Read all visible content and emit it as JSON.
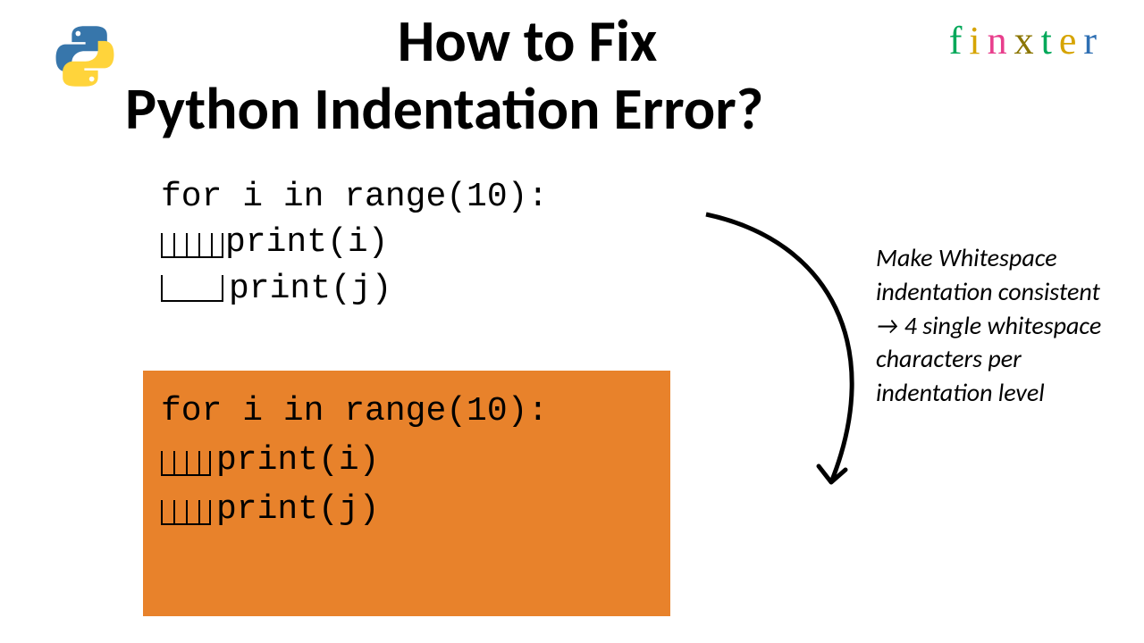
{
  "logos": {
    "python_alt": "python-logo",
    "finxter": {
      "f": "f",
      "i": "i",
      "n": "n",
      "x": "x",
      "t": "t",
      "e": "e",
      "r": "r"
    }
  },
  "headline_line1": "How to Fix",
  "headline_line2": "Python Indentation Error?",
  "code_top_line1": "for i in range(10):",
  "code_top_line2": "print(i)",
  "code_top_line3": "print(j)",
  "code_fix_line1": "for i in range(10):",
  "code_fix_line2": "print(i)",
  "code_fix_line3": "print(j)",
  "tip_text": "Make Whitespace indentation consistent → 4 single whitespace characters per indentation level"
}
